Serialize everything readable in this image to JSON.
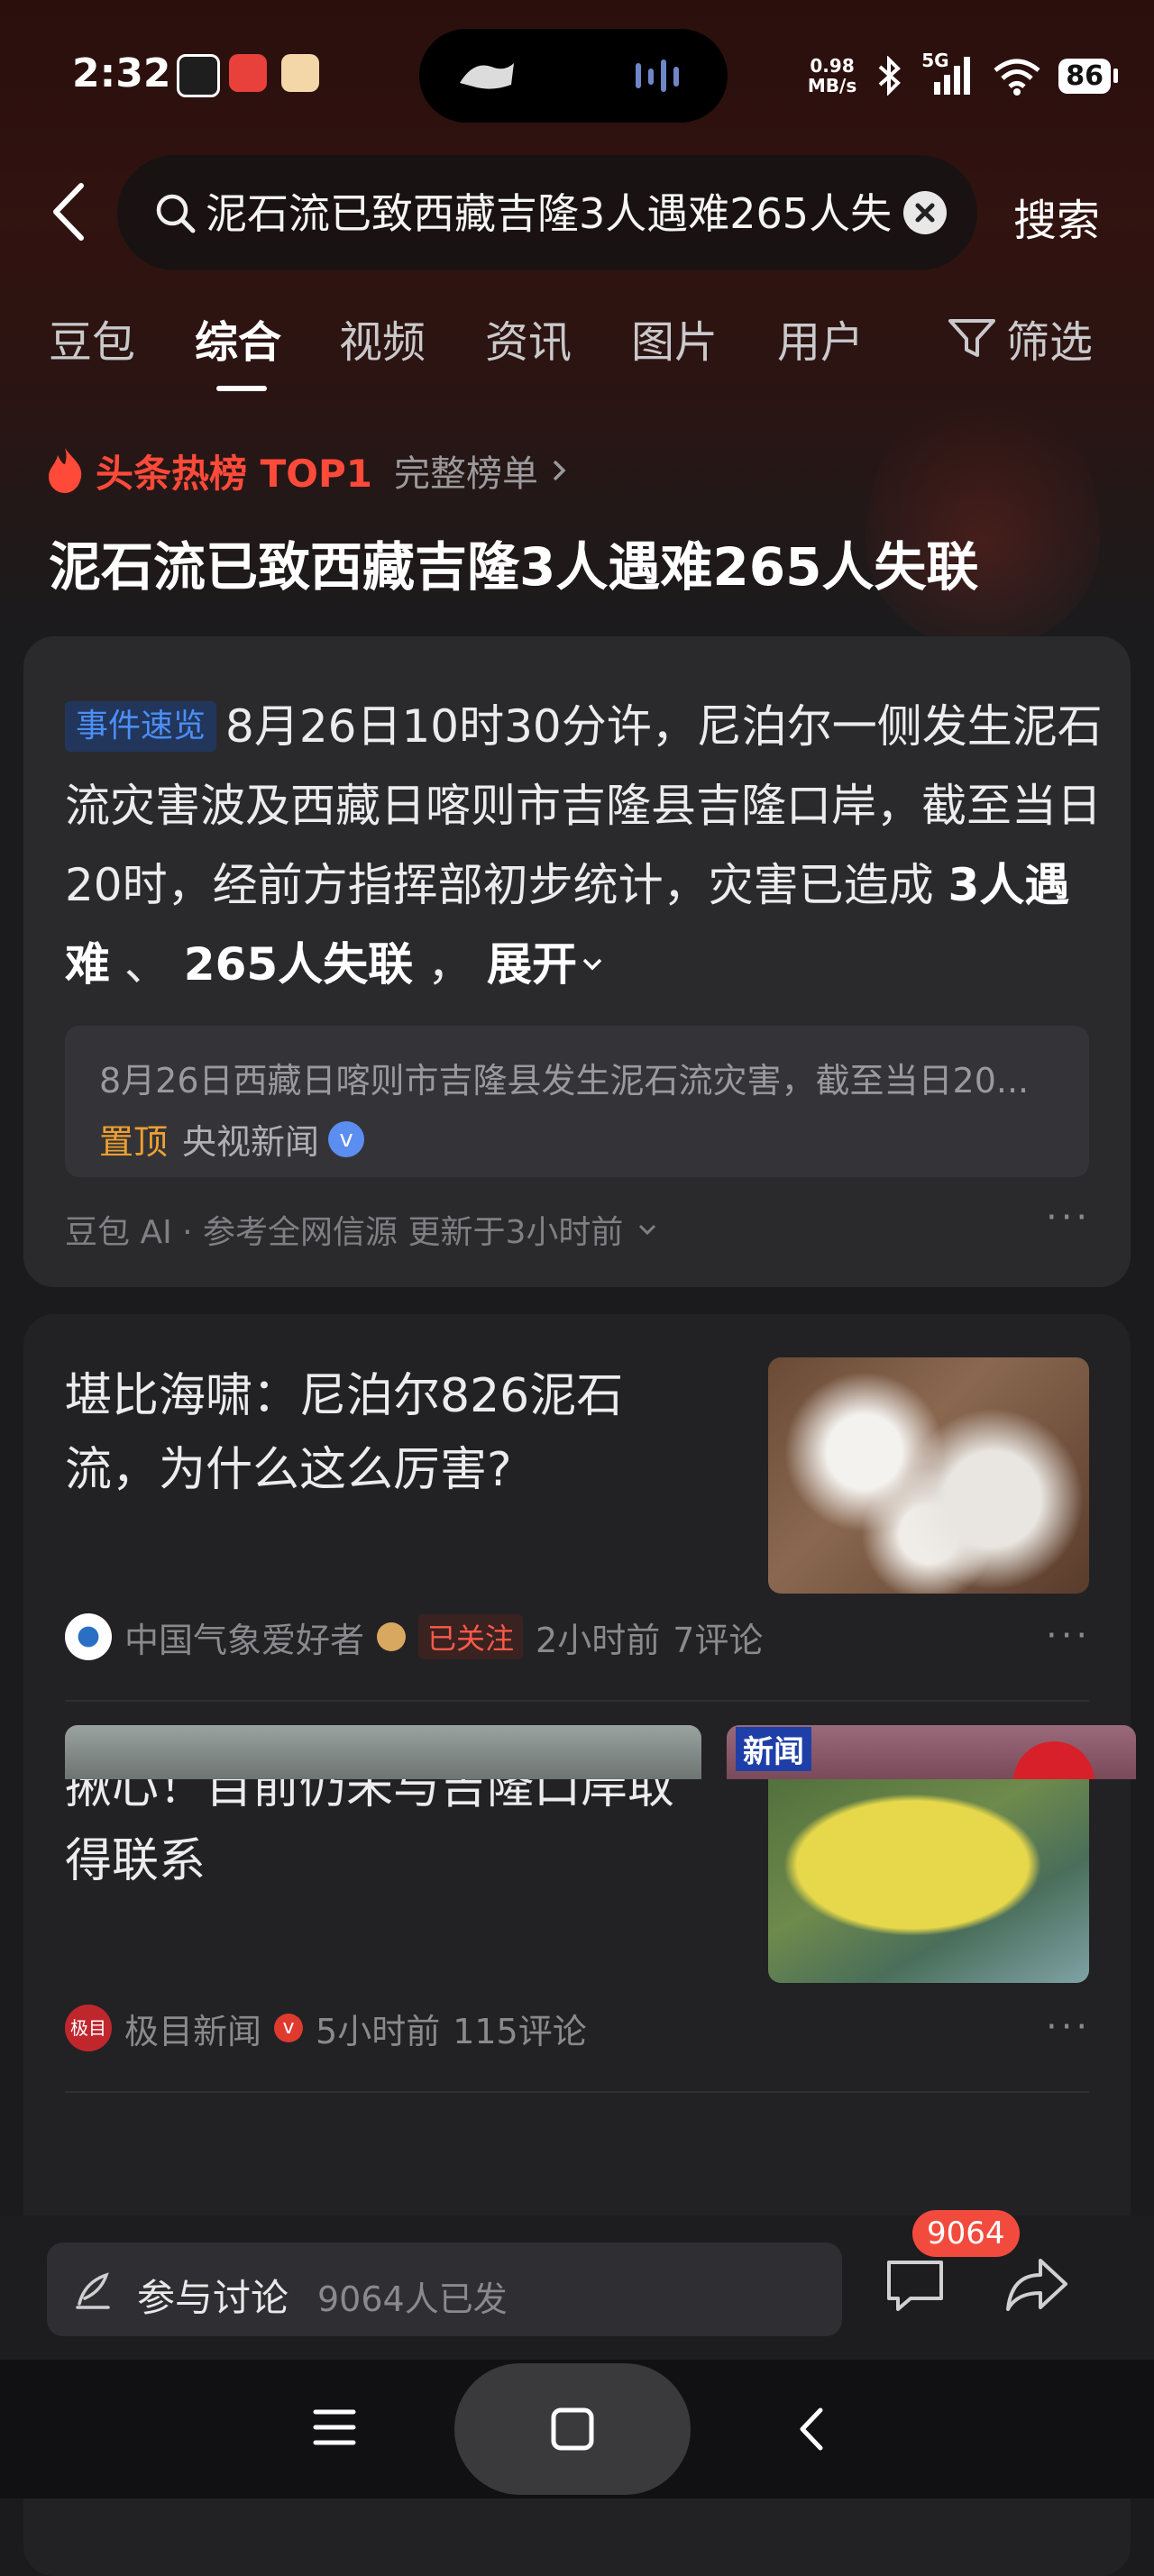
{
  "status_bar": {
    "time": "2:32",
    "speed_value": "0.98",
    "speed_unit": "MB/s",
    "signal_label": "5G",
    "battery": "86"
  },
  "search": {
    "query": "泥石流已致西藏吉隆3人遇难265人失联",
    "submit_label": "搜索"
  },
  "tabs": [
    "豆包",
    "综合",
    "视频",
    "资讯",
    "图片",
    "用户"
  ],
  "active_tab": "综合",
  "filter_label": "筛选",
  "hot": {
    "label": "头条热榜 TOP1",
    "full_list": "完整榜单",
    "headline": "泥石流已致西藏吉隆3人遇难265人失联"
  },
  "summary": {
    "badge": "事件速览",
    "text": "8月26日10时30分许，尼泊尔一侧发生泥石流灾害波及西藏日喀则市吉隆县吉隆口岸，截至当日20时，经前方指挥部初步统计，灾害已造成",
    "highlight1": "3人遇难",
    "separator": " 、 ",
    "highlight2": "265人失联",
    "comma": " ，",
    "expand": "展开",
    "source_text": "8月26日西藏日喀则市吉隆县发生泥石流灾害，截至当日20...",
    "pinned": "置顶",
    "source_name": "央视新闻",
    "ai_line": "豆包 AI · 参考全网信源 更新于3小时前"
  },
  "news": [
    {
      "title": "堪比海啸：尼泊尔826泥石流，为什么这么厉害?",
      "author": "中国气象爱好者",
      "follow": "已关注",
      "time": "2小时前",
      "comments": "7评论"
    },
    {
      "title": "揪心！目前仍未与吉隆口岸取得联系",
      "author": "极目新闻",
      "avatar_text": "极目",
      "time": "5小时前",
      "comments": "115评论"
    }
  ],
  "thumb3_tag": "新闻",
  "bottom": {
    "discuss_label": "参与讨论",
    "discuss_count": "9064人已发",
    "comment_badge": "9064"
  },
  "colors": {
    "hot_red": "#ff4a3a",
    "badge_blue": "#4c8ef5",
    "pin_orange": "#f0a030",
    "background": "#1b1b1d"
  }
}
